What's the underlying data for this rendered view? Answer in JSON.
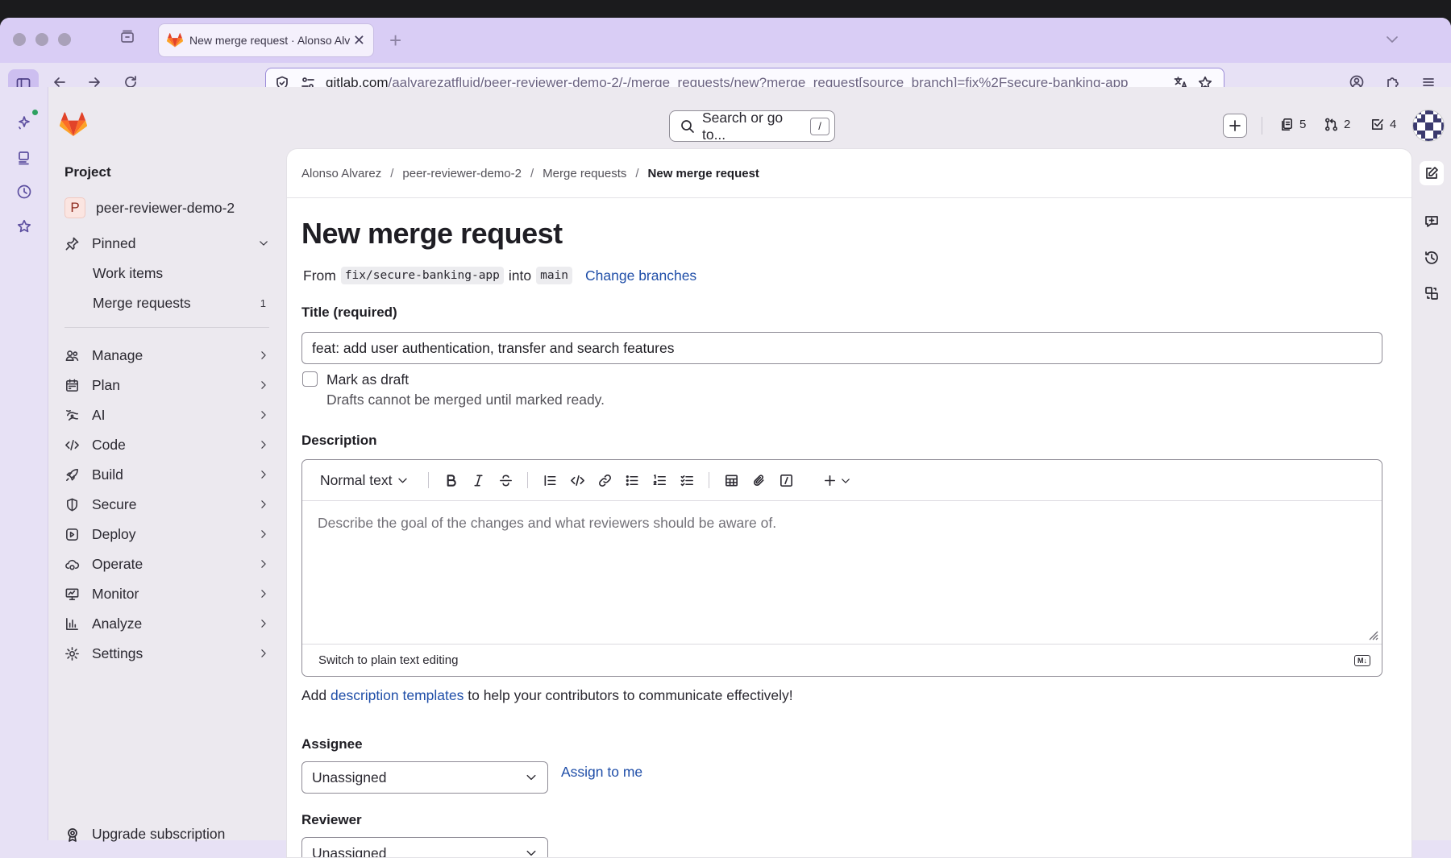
{
  "browser": {
    "tab_title": "New merge request · Alonso Alv",
    "url_host": "gitlab.com",
    "url_path": "/aalvarezatfluid/peer-reviewer-demo-2/-/merge_requests/new?merge_request[source_branch]=fix%2Fsecure-banking-app"
  },
  "topbar": {
    "search_label": "Search or go to...",
    "search_shortcut": "/",
    "issues_count": "5",
    "mr_count": "2",
    "todos_count": "4"
  },
  "sidebar": {
    "heading": "Project",
    "project_initial": "P",
    "project_name": "peer-reviewer-demo-2",
    "pinned_label": "Pinned",
    "pinned_items": [
      {
        "label": "Work items",
        "count": ""
      },
      {
        "label": "Merge requests",
        "count": "1"
      }
    ],
    "sections": [
      {
        "label": "Manage",
        "icon": "users-icon"
      },
      {
        "label": "Plan",
        "icon": "calendar-icon"
      },
      {
        "label": "AI",
        "icon": "ai-icon"
      },
      {
        "label": "Code",
        "icon": "code-icon"
      },
      {
        "label": "Build",
        "icon": "rocket-icon"
      },
      {
        "label": "Secure",
        "icon": "shield-icon"
      },
      {
        "label": "Deploy",
        "icon": "deploy-icon"
      },
      {
        "label": "Operate",
        "icon": "cloud-gear-icon"
      },
      {
        "label": "Monitor",
        "icon": "monitor-icon"
      },
      {
        "label": "Analyze",
        "icon": "chart-icon"
      },
      {
        "label": "Settings",
        "icon": "gear-icon"
      }
    ],
    "upgrade_label": "Upgrade subscription"
  },
  "breadcrumb": [
    "Alonso Alvarez",
    "peer-reviewer-demo-2",
    "Merge requests",
    "New merge request"
  ],
  "form": {
    "page_title": "New merge request",
    "from_word": "From",
    "source_branch": "fix/secure-banking-app",
    "into_word": "into",
    "target_branch": "main",
    "change_branches": "Change branches",
    "title_label": "Title (required)",
    "title_value": "feat: add user authentication, transfer and search features",
    "draft_label": "Mark as draft",
    "draft_help": "Drafts cannot be merged until marked ready.",
    "description_label": "Description",
    "text_style": "Normal text",
    "description_placeholder": "Describe the goal of the changes and what reviewers should be aware of.",
    "plain_text_toggle": "Switch to plain text editing",
    "markdown_badge": "M↓",
    "templates_prefix": "Add ",
    "templates_link": "description templates",
    "templates_suffix": " to help your contributors to communicate effectively!",
    "assignee_label": "Assignee",
    "assignee_value": "Unassigned",
    "assign_to_me": "Assign to me",
    "reviewer_label": "Reviewer",
    "reviewer_value": "Unassigned"
  },
  "colors": {
    "accent_link": "#1f4ea8",
    "browser_chrome": "#e7e1f5",
    "gitlab_orange": "#e24329"
  }
}
